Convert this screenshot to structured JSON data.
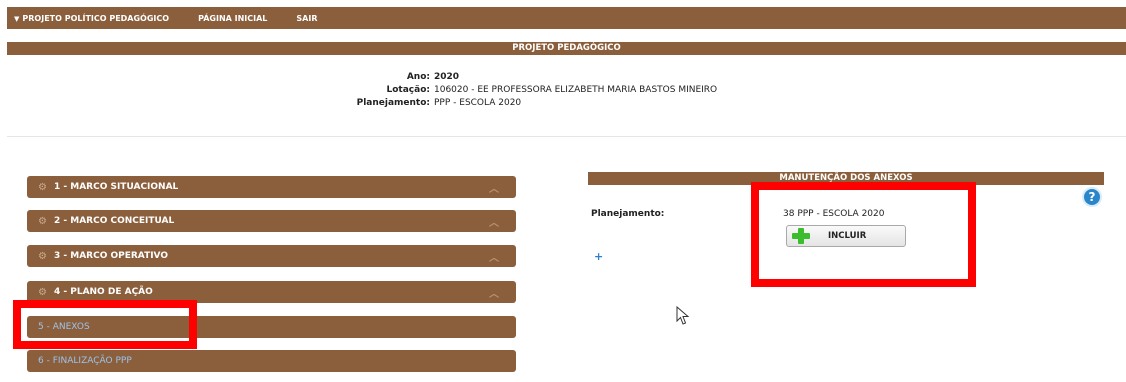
{
  "topnav": {
    "items": [
      {
        "label": "PROJETO POLÍTICO PEDAGÓGICO",
        "has_caret": true
      },
      {
        "label": "PÁGINA INICIAL"
      },
      {
        "label": "SAIR"
      }
    ]
  },
  "page_title": "PROJETO PEDAGÓGICO",
  "info": {
    "ano_label": "Ano:",
    "ano_value": "2020",
    "lotacao_label": "Lotação:",
    "lotacao_value": "106020 -  EE PROFESSORA ELIZABETH MARIA BASTOS MINEIRO",
    "planejamento_label": "Planejamento:",
    "planejamento_value": "PPP - ESCOLA 2020"
  },
  "sidebar": {
    "items": [
      {
        "label": "1 - MARCO SITUACIONAL",
        "icon": "gear-icon"
      },
      {
        "label": "2 - MARCO CONCEITUAL",
        "icon": "gear-icon"
      },
      {
        "label": "3 - MARCO OPERATIVO",
        "icon": "gear-icon"
      },
      {
        "label": "4 - PLANO DE AÇÃO",
        "icon": "gear-icon"
      },
      {
        "label": "5 - ANEXOS"
      },
      {
        "label": "6 - FINALIZAÇÃO PPP"
      }
    ]
  },
  "maintenance": {
    "title": "MANUTENÇÃO DOS ANEXOS",
    "planejamento_label": "Planejamento:",
    "planejamento_value": "38  PPP - ESCOLA 2020",
    "incluir_label": "INCLUIR",
    "add_symbol": "+",
    "help_symbol": "?"
  },
  "colors": {
    "brand_brown": "#8b5e3c",
    "highlight_red": "#ff0000",
    "link_blue": "#9cc3ea"
  }
}
